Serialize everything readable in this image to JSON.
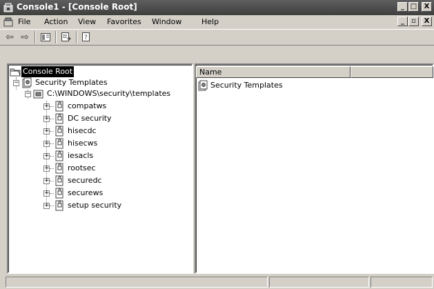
{
  "window": {
    "title": "Console1 - [Console Root]",
    "buttons": {
      "minimize": "_",
      "maximize": "□",
      "close": "X"
    }
  },
  "menu": {
    "items": [
      {
        "label": "File"
      },
      {
        "label": "Action"
      },
      {
        "label": "View"
      },
      {
        "label": "Favorites"
      },
      {
        "label": "Window"
      },
      {
        "label": "Help"
      }
    ],
    "child_buttons": {
      "minimize": "_",
      "restore": "▫",
      "close": "X"
    }
  },
  "toolbar": {
    "icons": [
      "back-icon",
      "forward-icon",
      "show-hide-tree-icon",
      "export-list-icon",
      "help-icon"
    ]
  },
  "tree": {
    "root": "Console Root",
    "child": "Security Templates",
    "path": "C:\\WINDOWS\\security\\templates",
    "templates": [
      "compatws",
      "DC security",
      "hisecdc",
      "hisecws",
      "iesacls",
      "rootsec",
      "securedc",
      "securews",
      "setup security"
    ]
  },
  "list": {
    "columns": [
      "Name",
      ""
    ],
    "rows": [
      "Security Templates"
    ]
  },
  "colors": {
    "titlebar": "#4a4a4a",
    "face": "#d4d0c8",
    "selection": "#000000"
  }
}
